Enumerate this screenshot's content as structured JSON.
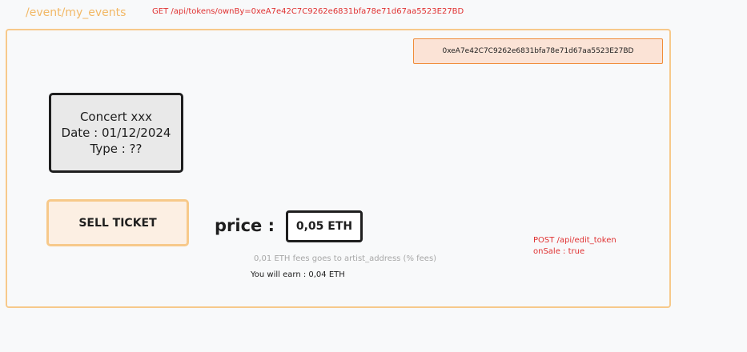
{
  "route": "/event/my_events",
  "api_get": "GET /api/tokens/ownBy=0xeA7e42C7C9262e6831bfa78e71d67aa5523E27BD",
  "wallet_address": "0xeA7e42C7C9262e6831bfa78e71d67aa5523E27BD",
  "event_card": {
    "name": "Concert xxx",
    "date": "Date : 01/12/2024",
    "type": "Type : ??"
  },
  "sell_button_label": "SELL TICKET",
  "price_label": "price :",
  "price_value": "0,05 ETH",
  "fees_note": "0,01 ETH fees goes to artist_address (% fees)",
  "earn_note": "You will earn : 0,04 ETH",
  "api_post": {
    "line1": "POST /api/edit_token",
    "line2": "onSale : true"
  },
  "colors": {
    "frame_border": "#f7c98a",
    "api_note": "#e03131",
    "wallet_bg": "#fbe3d6",
    "wallet_border": "#f08c3a",
    "card_bg": "#e9e9e9",
    "sell_bg": "#fcefe3"
  }
}
